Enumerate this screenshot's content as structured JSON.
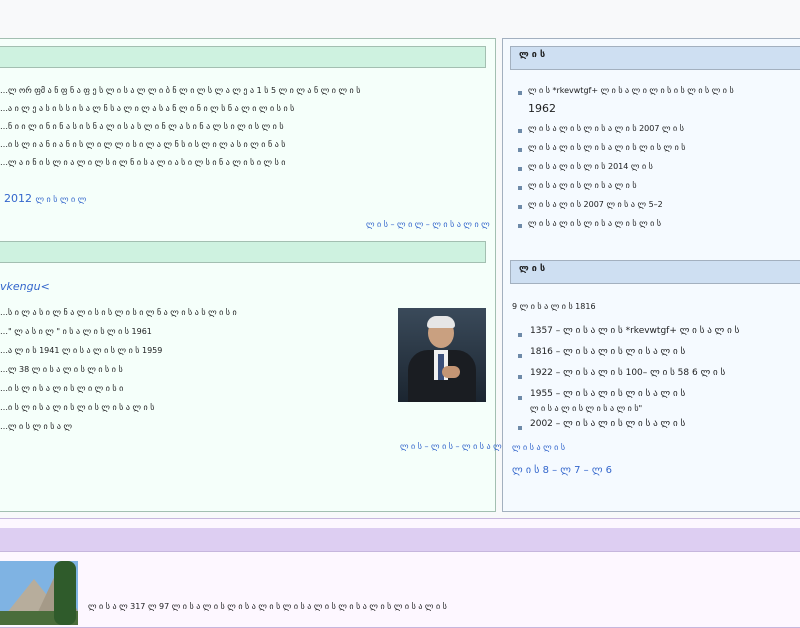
{
  "left": {
    "section1_lines": [
      "…ლ ორ ფმ ა ნ ფ ნ ა ფ ე ს ლ ი ს ა ლ ლ ი ბ ნ ლ ი ლ ს  ლ ა ლ ე ა 1 ს 5 ლ ი  ლ ა ნ ლ ი ლ ი ს",
      "…ა ი ლ ე ა ს ი ს ს ი ს ა ლ ნ ს ა ლ ი ლ ა ს ა ნ ლ ი ნ ი ლ ს ნ ა ლ ი ლ ი ს ი ს",
      "…ნ ი ი ლ ი ნ ი ნ ა ს ი ს ნ ა ლ ი ს ა ს ლ ი ნ ლ ა ს ი ნ ა ლ ს ი ლ ი ს ლ ი ს",
      "…ი ს ლ ი ა ნ ი ა ნ ი ს ლ ი ლ ლ ი ს ი ლ ა ლ ნ ს ი ს ლ ი ლ ა ს ი ლ ი ნ ა ს",
      "…ლ ა ი ნ ი ს ლ ი ა ლ ი ლ ს ი ლ ნ ი ს ა ლ ი ა ს ი ლ ს ი ნ ა ლ ი ს ი ლ ს ი"
    ],
    "section1_last": "2012",
    "section1_last_tail": "ლ ი ს ლ ი ლ",
    "section1_more": "ლ ი ს – ლ ი ლ – ლ ი ს ა ლ ი ლ",
    "section2_subtitle": "vkengu<",
    "section2_lines": [
      "…ს ი ლ ა ს ი ლ ნ ა ლ ი ს ი ს ლ ი ს ი ლ ნ ა ლ ი ს ა ს ლ ი ს ი",
      "…\" ლ ა ს ი ლ \" ი ს ა ლ ი ს ლ ი ს 1961",
      "…ა ლ ი ს 1941 ლ ი ს ა ლ ი ს ლ ი ს 1959",
      "…ლ 38 ლ ი ს ა ლ ი ს ლ ი ს ი ს",
      "…ი ს ლ ი ს ა ლ ი ს ლ ი ლ ი ს ი",
      "…ი ს ლ ი ს ა ლ ი ს ლ ი ს ლ ი ს ა ლ ი ს",
      "…ლ ი ს ლ ი ს ა ლ"
    ],
    "section2_more": "ლ ი ს – ლ ი ს – ლ ი ს ა ლ ი ლ"
  },
  "right": {
    "head1": "ლ ი ს",
    "items1": [
      "ლ ი ს *rkevwtgf+ ლ ი ს ა ლ ი ლ ი ს ი ს ლ ი ს ლ ი ს",
      "1962",
      "ლ ი ს ა ლ ი ს ლ ი ს ა ლ ი ს 2007 ლ ი ს",
      "ლ ი ს ა ლ ი ს ლ ი ს ა ლ ი ს ლ ი ს ლ ი ს",
      "ლ ი ს ა ლ ი ს ლ ი ს 2014 ლ ი ს",
      "ლ ი ს ა ლ ი ს ლ ი ს ა ლ ი ს",
      "ლ ი ს ა ლ ი ს 2007 ლ ი ს ა ლ 5–2",
      "ლ ი ს ა ლ ი ს ლ ი ს ა ლ ი ს ლ ი ს"
    ],
    "head2": "ლ ი ს",
    "subhead2": "9 ლ ი ს ა ლ ი ს 1816",
    "items2": [
      "1357 – ლ ი ს ა ლ ი ს *rkevwtgf+ ლ ი ს ა ლ ი ს",
      "1816 – ლ ი ს ა ლ ი ს ლ ი ს ა ლ ი ს",
      "1922 – ლ ი ს ა ლ ი ს 100– ლ ი ს 58 6 ლ ი ს",
      "1955 – ლ ი ს ა ლ ი ს ლ ი ს ა ლ ი ს",
      "ლ ი ს ა ლ ი ს ლ ი ს ა ლ ი ს\"",
      "2002 – ლ ი ს ა ლ ი ს ლ ი ს ა ლ ი ს"
    ],
    "footer1": "ლ ი ს ა ლ ი ს",
    "footer2": "ლ ი ს 8 – ლ 7 – ლ 6"
  },
  "bottom": {
    "line": "ლ ი ს ა ლ 317 ლ 97 ლ ი ს ა ლ ი ს ლ ი ს ა ლ ი ს ლ ი ს ა ლ ი ს ლ ი ს ა ლ ი ს ლ ი ს ა ლ ი ს"
  }
}
